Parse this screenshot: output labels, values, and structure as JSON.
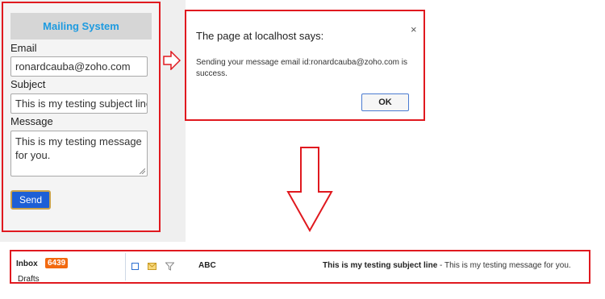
{
  "form": {
    "title": "Mailing System",
    "email_label": "Email",
    "email_value": "ronardcauba@zoho.com",
    "subject_label": "Subject",
    "subject_value": "This is my testing subject line",
    "message_label": "Message",
    "message_value": "This is my testing message for you.",
    "send_label": "Send"
  },
  "dialog": {
    "title": "The page at localhost says:",
    "close_glyph": "×",
    "message": "Sending your message email id:ronardcauba@zoho.com is success.",
    "ok_label": "OK"
  },
  "inbox": {
    "folder_label": "Inbox",
    "unread_count": "6439",
    "drafts_label": "Drafts",
    "sender": "ABC",
    "subject": "This is my testing subject line",
    "snippet": " - This is my testing message for you."
  },
  "icons": [
    "arrow-right-icon",
    "arrow-down-icon",
    "checkbox-icon",
    "envelope-icon",
    "filter-icon",
    "close-icon"
  ],
  "colors": {
    "highlight_border": "#e0191f",
    "title_text": "#1e9be0",
    "send_button": "#1d5fd6",
    "badge": "#f26a10"
  }
}
